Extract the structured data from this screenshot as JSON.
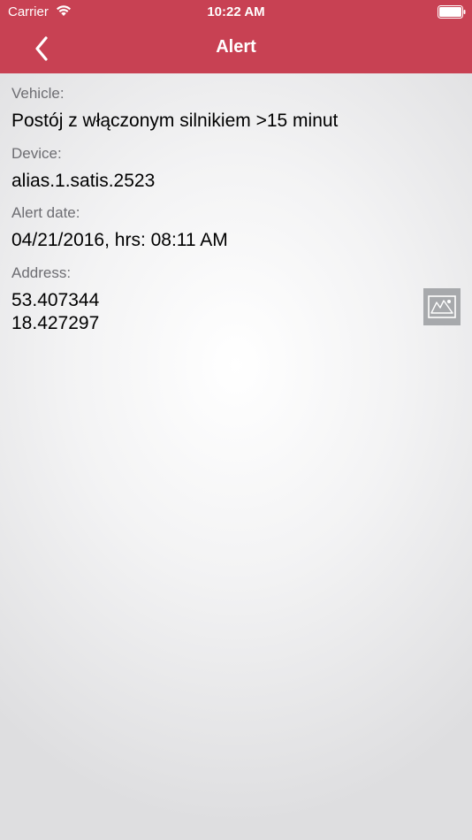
{
  "status_bar": {
    "carrier": "Carrier",
    "time": "10:22 AM",
    "wifi_icon": "wifi-icon",
    "battery_icon": "battery-icon"
  },
  "nav": {
    "title": "Alert",
    "back_icon": "chevron-left-icon",
    "bar_color": "#c84153"
  },
  "details": {
    "vehicle_label": "Vehicle:",
    "vehicle_value": "Postój z włączonym silnikiem >15 minut",
    "device_label": "Device:",
    "device_value": "alias.1.satis.2523",
    "alert_date_label": "Alert date:",
    "alert_date_value": "04/21/2016, hrs: 08:11 AM",
    "address_label": "Address:",
    "latitude": "53.407344",
    "longitude": "18.427297",
    "map_icon": "map-icon"
  }
}
